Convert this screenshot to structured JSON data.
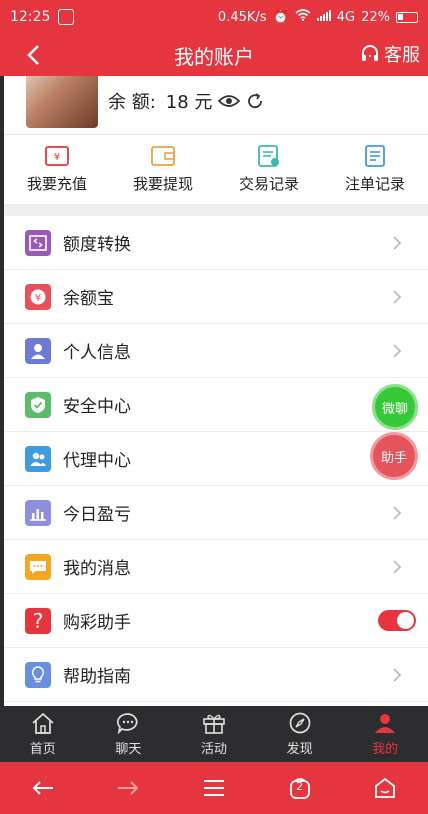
{
  "status_bar": {
    "time": "12:25",
    "speed": "0.45K/s",
    "network": "4G",
    "battery": "22%"
  },
  "header": {
    "title": "我的账户",
    "service_label": "客服"
  },
  "profile": {
    "balance_label": "余 额:",
    "balance_amount": "18 元"
  },
  "quick_actions": [
    {
      "label": "我要充值",
      "icon": "recharge-icon",
      "color": "#e5353e"
    },
    {
      "label": "我要提现",
      "icon": "withdraw-icon",
      "color": "#f0a040"
    },
    {
      "label": "交易记录",
      "icon": "transaction-icon",
      "color": "#3cb8b0"
    },
    {
      "label": "注单记录",
      "icon": "bet-record-icon",
      "color": "#3f9be0"
    }
  ],
  "menu": [
    {
      "label": "额度转换",
      "icon": "transfer-icon",
      "color": "#9a59b5"
    },
    {
      "label": "余额宝",
      "icon": "yuebao-icon",
      "color": "#e8505b"
    },
    {
      "label": "个人信息",
      "icon": "user-icon",
      "color": "#6b7bd6"
    },
    {
      "label": "安全中心",
      "icon": "shield-icon",
      "color": "#5bbd6a"
    },
    {
      "label": "代理中心",
      "icon": "agent-icon",
      "color": "#3f9be0"
    },
    {
      "label": "今日盈亏",
      "icon": "chart-icon",
      "color": "#8f8fe0"
    },
    {
      "label": "我的消息",
      "icon": "message-icon",
      "color": "#f5a623"
    },
    {
      "label": "购彩助手",
      "icon": "question-icon",
      "color": "#e5353e",
      "toggle_on": true
    },
    {
      "label": "帮助指南",
      "icon": "bulb-icon",
      "color": "#6b8fe0"
    }
  ],
  "floating": {
    "chat_label": "微聊",
    "helper_label": "助手"
  },
  "tabs": [
    {
      "label": "首页",
      "icon": "home-icon"
    },
    {
      "label": "聊天",
      "icon": "chat-icon"
    },
    {
      "label": "活动",
      "icon": "gift-icon"
    },
    {
      "label": "发现",
      "icon": "compass-icon"
    },
    {
      "label": "我的",
      "icon": "profile-icon",
      "active": true
    }
  ],
  "bottom_nav": {
    "tab_count": "2"
  },
  "colors": {
    "brand_red": "#e5353e",
    "tabbar_bg": "#2d2d30"
  }
}
